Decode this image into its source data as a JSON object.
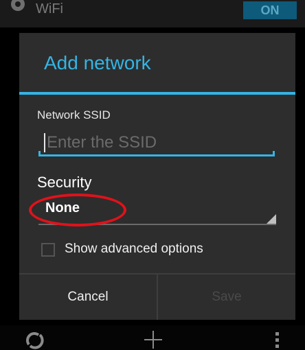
{
  "background": {
    "title": "WiFi",
    "toggle_label": "ON"
  },
  "dialog": {
    "title": "Add network",
    "ssid": {
      "label": "Network SSID",
      "placeholder": "Enter the SSID",
      "value": ""
    },
    "security": {
      "label": "Security",
      "selected": "None"
    },
    "advanced": {
      "label": "Show advanced options",
      "checked": false
    },
    "buttons": {
      "cancel": "Cancel",
      "save": "Save"
    }
  },
  "bottom_bar": {
    "icons": [
      "refresh-icon",
      "add-icon",
      "overflow-menu-icon"
    ]
  },
  "colors": {
    "accent": "#33b5e5",
    "dialog_bg": "#2d2d2d",
    "highlight": "#e0121b"
  }
}
